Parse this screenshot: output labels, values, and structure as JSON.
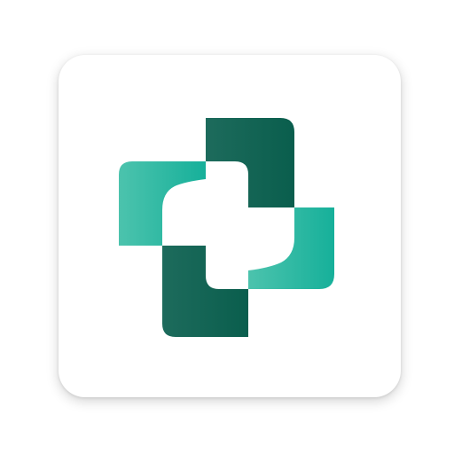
{
  "app_icon": {
    "icon": "medical-cross-logo-icon",
    "colors": {
      "background": "#ffffff",
      "tile": "#ffffff",
      "teal_light": "#4cc3ad",
      "teal": "#16b09a",
      "green_dark": "#1d6b5c",
      "green_deep": "#0a5e4d"
    }
  }
}
